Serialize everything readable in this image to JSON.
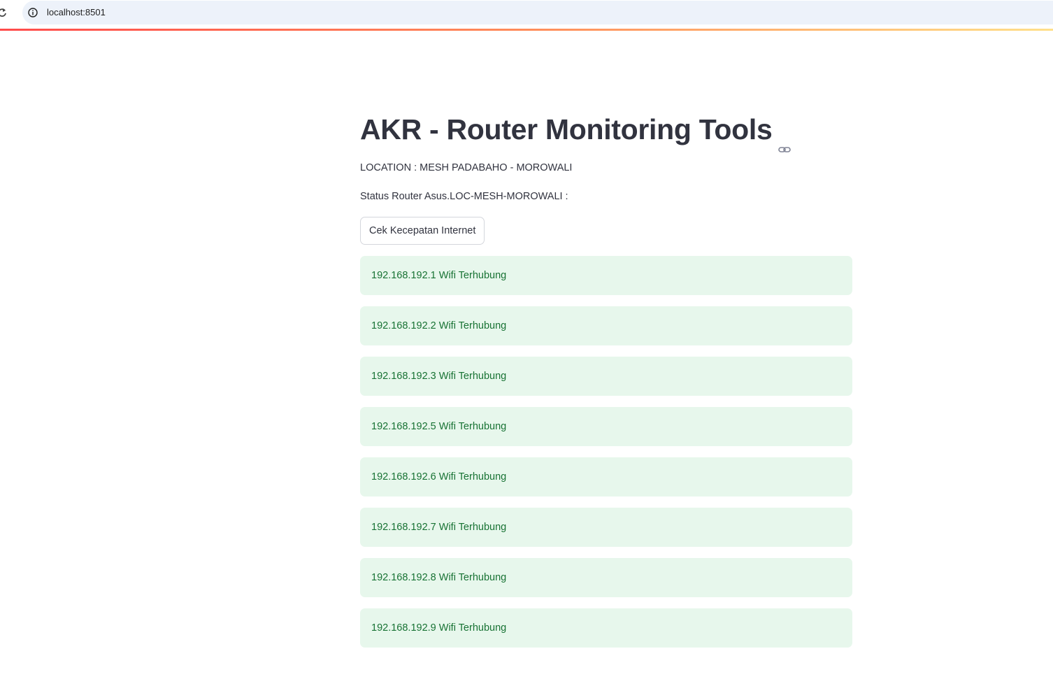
{
  "browser": {
    "url": "localhost:8501"
  },
  "page": {
    "title": "AKR - Router Monitoring Tools",
    "location": "LOCATION : MESH PADABAHO - MOROWALI",
    "status_label": "Status Router Asus.LOC-MESH-MOROWALI :",
    "speed_button_label": "Cek Kecepatan Internet"
  },
  "status_items": [
    {
      "text": "192.168.192.1 Wifi Terhubung"
    },
    {
      "text": "192.168.192.2 Wifi Terhubung"
    },
    {
      "text": "192.168.192.3 Wifi Terhubung"
    },
    {
      "text": "192.168.192.5 Wifi Terhubung"
    },
    {
      "text": "192.168.192.6 Wifi Terhubung"
    },
    {
      "text": "192.168.192.7 Wifi Terhubung"
    },
    {
      "text": "192.168.192.8 Wifi Terhubung"
    },
    {
      "text": "192.168.192.9 Wifi Terhubung"
    }
  ],
  "colors": {
    "success_bg": "#e7f7ec",
    "success_text": "#177233",
    "text": "#31333f",
    "accent_gradient_start": "#ff4b4b",
    "accent_gradient_end": "#ffe08a"
  },
  "icons": {
    "reload": "reload-icon",
    "site_info": "info-icon",
    "heading_anchor": "link-icon"
  }
}
